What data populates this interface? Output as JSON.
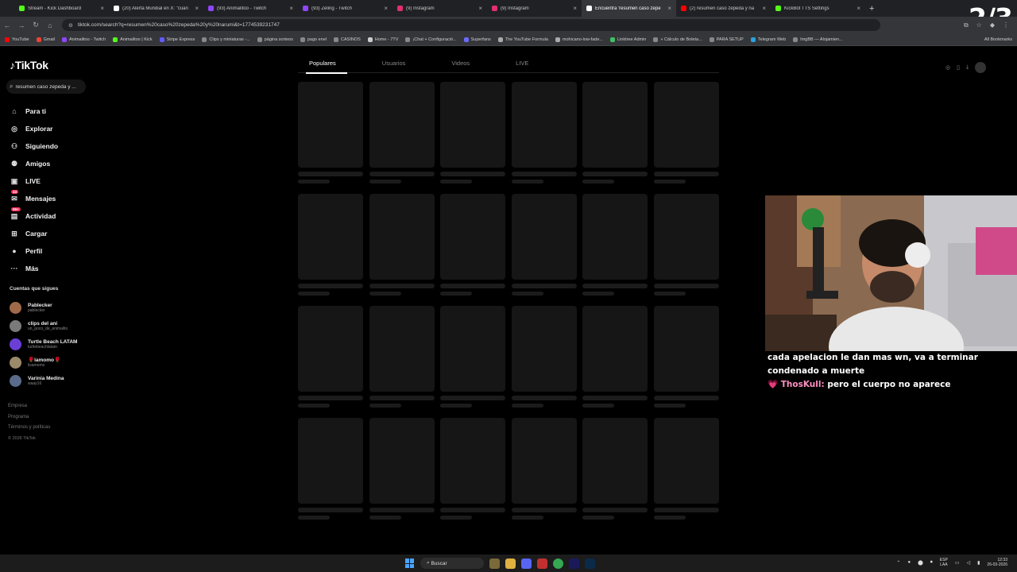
{
  "browser": {
    "tabs": [
      {
        "label": "Stream - Kick Dashboard",
        "color": "#53fc18"
      },
      {
        "label": "(20) Alerta Mundial en X: \"cuan",
        "color": "#ffffff"
      },
      {
        "label": "(93) Animalitoo - Twitch",
        "color": "#9146ff"
      },
      {
        "label": "(93) Zeling - Twitch",
        "color": "#9146ff"
      },
      {
        "label": "(9) Instagram",
        "color": "#e1306c"
      },
      {
        "label": "(9) Instagram",
        "color": "#e1306c"
      },
      {
        "label": "Encuentra 'resumen caso zepe",
        "color": "#ffffff"
      },
      {
        "label": "(2) resumen caso zepeda y na",
        "color": "#ff0000"
      },
      {
        "label": "KickBot TTS Settings",
        "color": "#53fc18"
      }
    ],
    "url": "tiktok.com/search?q=resumen%20caso%20zepeda%20y%20narumi&t=1774539231747",
    "overlay_counter": "2/3",
    "bookmarks": [
      "YouTube",
      "Gmail",
      "Animalitoo - Twitch",
      "Animalitoo | Kick",
      "Stripe Express",
      "Clips y miniaturas -...",
      "página sorteos",
      "pago enel",
      "CASINOS",
      "Home - 7TV",
      "¡Chat + Configuració...",
      "Superfans",
      "The YouTube Formula",
      "mohicano-low-fade...",
      "Linktree Admin",
      "» Cálculo de Boleta...",
      "PARA SETUP",
      "Telegram Web",
      "ImgBB — Alojamien..."
    ],
    "all_bookmarks": "All Bookmarks"
  },
  "tiktok": {
    "logo": "TikTok",
    "search_value": "resumen caso zepeda y ...",
    "nav": [
      {
        "label": "Para ti",
        "icon": "home-icon",
        "glyph": "⌂"
      },
      {
        "label": "Explorar",
        "icon": "compass-icon",
        "glyph": "◎"
      },
      {
        "label": "Siguiendo",
        "icon": "following-icon",
        "glyph": "⚇"
      },
      {
        "label": "Amigos",
        "icon": "friends-icon",
        "glyph": "⚉"
      },
      {
        "label": "LIVE",
        "icon": "live-icon",
        "glyph": "▣"
      },
      {
        "label": "Mensajes",
        "icon": "messages-icon",
        "glyph": "✉",
        "badge": "43"
      },
      {
        "label": "Actividad",
        "icon": "activity-icon",
        "glyph": "▤",
        "badge": "99+"
      },
      {
        "label": "Cargar",
        "icon": "upload-icon",
        "glyph": "⊞"
      },
      {
        "label": "Perfil",
        "icon": "profile-icon",
        "glyph": "●"
      },
      {
        "label": "Más",
        "icon": "more-icon",
        "glyph": "···"
      }
    ],
    "following_title": "Cuentas que sigues",
    "following": [
      {
        "name": "Pablecker",
        "handle": "pablecker",
        "color": "#a06a4a"
      },
      {
        "name": "clips del ani",
        "handle": "un_poco_de_animalito",
        "color": "#7a7a7a"
      },
      {
        "name": "Turtle Beach LATAM",
        "handle": "turtlebeachlatam",
        "color": "#6b3fd6"
      },
      {
        "name": "🌹lamomo🌹",
        "handle": "lisamomo",
        "color": "#9a8a6a"
      },
      {
        "name": "Varinia Medina",
        "handle": "waay16",
        "color": "#5a6a8a"
      }
    ],
    "footer": [
      "Empresa",
      "Programa",
      "Términos y políticas"
    ],
    "copyright": "© 2026 TikTok",
    "search_tabs": [
      "Populares",
      "Usuarios",
      "Videos",
      "LIVE"
    ]
  },
  "stream": {
    "chat_line1": "cada apelacion le dan mas wn, va a terminar condenado a muerte",
    "chat_user": "ThosKull:",
    "chat_message": "pero el cuerpo no aparece"
  },
  "taskbar": {
    "search_placeholder": "Buscar",
    "lang_line1": "ESP",
    "lang_line2": "LAA",
    "time": "12:33",
    "date": "26-03-2026"
  }
}
